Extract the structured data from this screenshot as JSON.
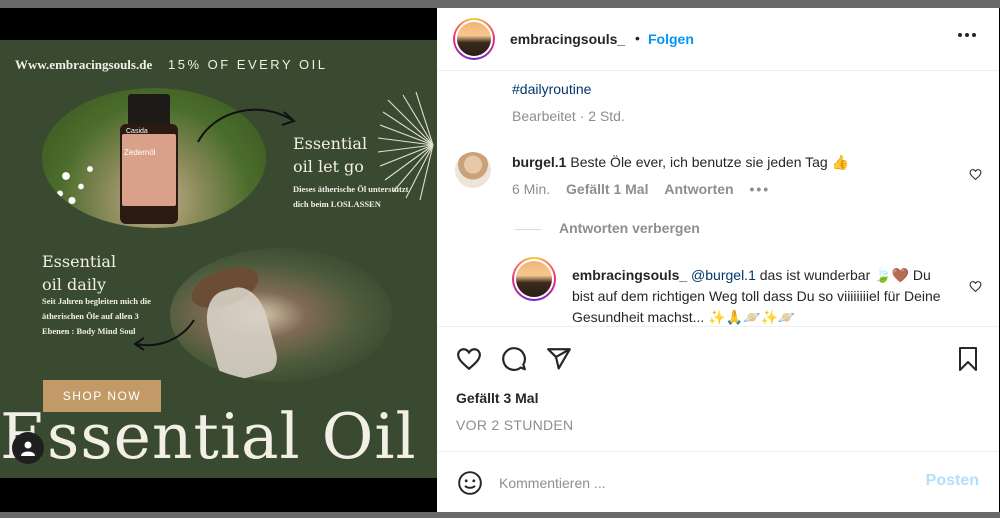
{
  "image": {
    "site_url": "Www.embracingsouls.de",
    "promo": "15% OF EVERY OIL",
    "bottle_brand": "Casida",
    "bottle_name": "Zedernöl",
    "block1_title_line1": "Essential",
    "block1_title_line2": "oil let go",
    "block1_desc": "Dieses ätherische Öl unterstützt dich beim LOSLASSEN",
    "block2_title_line1": "Essential",
    "block2_title_line2": "oil daily",
    "block2_desc": "Seit Jahren begleiten mich die ätherischen Öle auf allen 3 Ebenen : Body Mind Soul",
    "shop_button": "SHOP NOW",
    "big_title": "Essential Oil",
    "colors": {
      "background": "#3a4a31",
      "button": "#c29a67",
      "text": "#f1efe6"
    }
  },
  "header": {
    "username": "embracingsouls_",
    "separator": "•",
    "follow_label": "Folgen",
    "more_icon": "more-horizontal-icon"
  },
  "caption": {
    "hashtag": "#dailyroutine",
    "edited": "Bearbeitet · 2 Std."
  },
  "comments": [
    {
      "username": "burgel.1",
      "text": "Beste Öle ever, ich benutze sie jeden Tag 👍",
      "time": "6 Min.",
      "likes": "Gefällt 1 Mal",
      "reply_label": "Antworten",
      "more": "•••"
    }
  ],
  "hide_replies_label": "Antworten verbergen",
  "reply": {
    "username": "embracingsouls_",
    "mention": "@burgel.1",
    "text": "das ist wunderbar 🍃🤎 Du bist auf dem richtigen Weg toll dass Du so viiiiiiiiel für Deine Gesundheit machst... ✨🙏🪐✨🪐"
  },
  "actions": {
    "likes": "Gefällt 3 Mal",
    "posted": "VOR 2 STUNDEN"
  },
  "comment_bar": {
    "placeholder": "Kommentieren ...",
    "post_label": "Posten",
    "colors": {
      "post": "#b2dffc",
      "link": "#0095f6"
    }
  }
}
